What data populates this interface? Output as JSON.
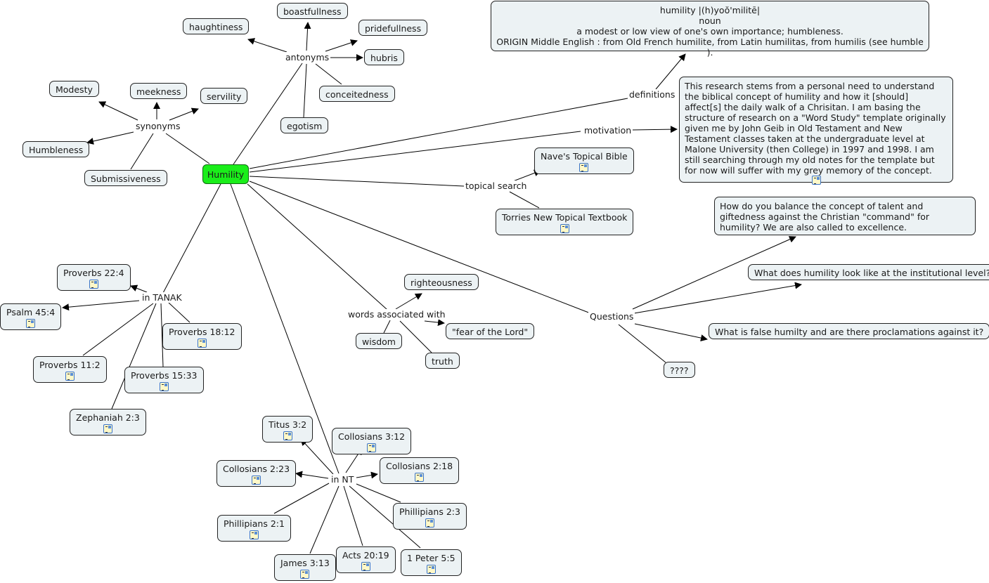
{
  "root": {
    "label": "Humility",
    "color": "#1aee1a"
  },
  "linking_phrases": {
    "antonyms": "antonyms",
    "synonyms": "synonyms",
    "definitions": "definitions",
    "motivation": "motivation",
    "topical_search": "topical search",
    "in_tanak": "in TANAK",
    "in_nt": "in NT",
    "words_associated": "words associated with",
    "questions": "Questions"
  },
  "antonyms": [
    "boastfullness",
    "haughtiness",
    "pridefullness",
    "hubris",
    "conceitedness",
    "egotism"
  ],
  "synonyms": [
    "Modesty",
    "meekness",
    "servility",
    "Humbleness",
    "Submissiveness"
  ],
  "definition": {
    "line1": "humility |(h)yoŏ'militē|",
    "line2": "noun",
    "line3": "a modest or low view of one's own importance; humbleness.",
    "line4": "ORIGIN Middle English : from Old French humilite, from Latin humilitas, from humilis (see humble )."
  },
  "motivation_text": "This research stems from a personal need to understand the biblical concept of humility and how it [should] affect[s] the daily walk of a Chrisitan. I am basing the structure of research on a \"Word Study\" template originally given me by John Geib in Old Testament and New Testament classes taken at the undergraduate level at Malone University (then College) in 1997 and 1998. I am still searching through my old notes for the template but for now will suffer with my grey memory of the concept.",
  "topical_search": [
    "Nave's Topical Bible",
    "Torries New Topical Textbook"
  ],
  "tanak": [
    "Proverbs 22:4",
    "Psalm 45:4",
    "Proverbs 18:12",
    "Proverbs 11:2",
    "Proverbs 15:33",
    "Zephaniah 2:3"
  ],
  "nt": [
    "Titus 3:2",
    "Collosians 3:12",
    "Collosians 2:23",
    "Collosians 2:18",
    "Phillipians 2:3",
    "Phillipians 2:1",
    "James 3:13",
    "Acts 20:19",
    "1 Peter 5:5"
  ],
  "associated": [
    "righteousness",
    "\"fear of the Lord\"",
    "wisdom",
    "truth"
  ],
  "questions": [
    "How do you balance the concept of talent and giftedness against the Christian \"command\" for humility? We are also called to excellence.",
    "What does humility look like at the institutional level?",
    "What is false humilty and are there proclamations against it?",
    "????"
  ]
}
